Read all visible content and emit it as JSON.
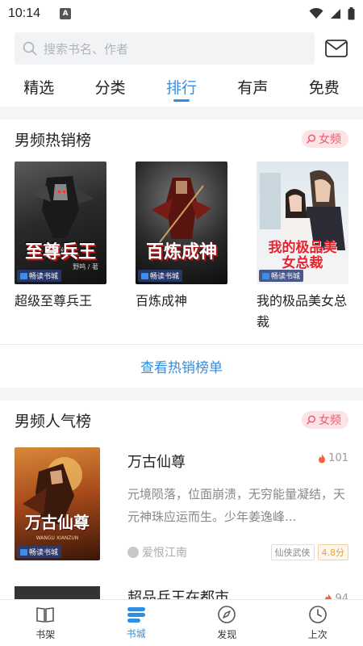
{
  "status_bar": {
    "time": "10:14",
    "notification_letter": "A"
  },
  "search": {
    "placeholder": "搜索书名、作者"
  },
  "tabs": [
    {
      "label": "精选",
      "active": false
    },
    {
      "label": "分类",
      "active": false
    },
    {
      "label": "排行",
      "active": true
    },
    {
      "label": "有声",
      "active": false
    },
    {
      "label": "免费",
      "active": false
    }
  ],
  "bestseller": {
    "title": "男频热销榜",
    "badge": "女频",
    "books": [
      {
        "name": "超级至尊兵王",
        "cover_text": "至尊兵王",
        "cover_small_top": "超级",
        "cover_author": "野鸣 / 著",
        "publisher": "畅读书城"
      },
      {
        "name": "百炼成神",
        "cover_text": "百炼成神",
        "cover_author": "",
        "publisher": "畅读书城"
      },
      {
        "name": "我的极品美女总裁",
        "cover_text": "我的极品美女总裁",
        "cover_author": "",
        "publisher": "畅读书城"
      }
    ],
    "view_more": "查看热销榜单"
  },
  "popular": {
    "title": "男频人气榜",
    "badge": "女频",
    "items": [
      {
        "name": "万古仙尊",
        "heat": "101",
        "description": "元境陨落，位面崩溃，无穷能量凝结，天元神珠应运而生。少年姜逸峰...",
        "author": "爱恨江南",
        "category": "仙侠武侠",
        "score": "4.8分",
        "cover_text": "万古仙尊",
        "cover_sub": "WANGU XIANZUN",
        "publisher": "畅读书城"
      },
      {
        "name": "超品兵王在都市",
        "heat": "94"
      }
    ]
  },
  "bottom_nav": [
    {
      "label": "书架",
      "icon": "book-icon",
      "active": false
    },
    {
      "label": "书城",
      "icon": "store-icon",
      "active": true
    },
    {
      "label": "发现",
      "icon": "compass-icon",
      "active": false
    },
    {
      "label": "上次",
      "icon": "clock-icon",
      "active": false
    }
  ],
  "colors": {
    "accent": "#2f8fe3",
    "badge_text": "#f05a6e",
    "badge_bg": "#fbe3e6"
  }
}
